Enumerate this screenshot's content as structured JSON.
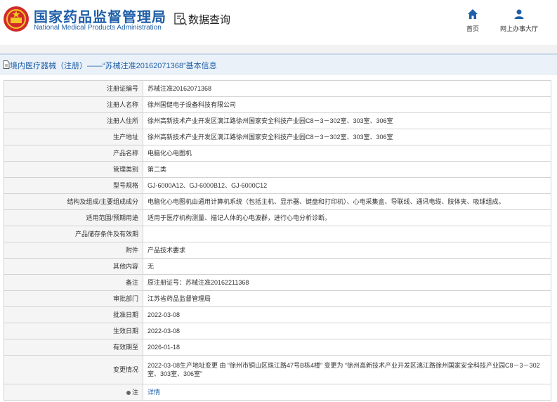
{
  "header": {
    "site_name": "国家药品监督管理局",
    "site_name_en": "National Medical Products Administration",
    "query_title": "数据查询",
    "nav": [
      {
        "label": "首页",
        "icon": "home-icon"
      },
      {
        "label": "网上办事大厅",
        "icon": "user-icon"
      }
    ]
  },
  "colors": {
    "brand": "#1f5fa8",
    "title_bar_bg": "#eaf1f8",
    "label_bg": "#f5f5f5"
  },
  "page": {
    "title": "境内医疗器械（注册）——“苏械注准20162071368”基本信息"
  },
  "fields": [
    {
      "label": "注册证编号",
      "value": "苏械注准20162071368"
    },
    {
      "label": "注册人名称",
      "value": "徐州国健电子设备科技有限公司"
    },
    {
      "label": "注册人住所",
      "value": "徐州高新技术产业开发区漓江路徐州国家安全科技产业园C8－3－302室、303室、306室"
    },
    {
      "label": "生产地址",
      "value": "徐州高新技术产业开发区漓江路徐州国家安全科技产业园C8－3－302室、303室、306室"
    },
    {
      "label": "产品名称",
      "value": "电脑化心电图机"
    },
    {
      "label": "管理类别",
      "value": "第二类"
    },
    {
      "label": "型号规格",
      "value": "GJ-6000A12、GJ-6000B12、GJ-6000C12"
    },
    {
      "label": "结构及组成/主要组成成分",
      "value": "电脑化心电图机由通用计算机系统（包括主机、显示器、键盘和打印机）、心电采集盒、导联线、通讯电缆、肢体夹、吸球组成。"
    },
    {
      "label": "适用范围/预期用途",
      "value": "适用于医疗机构测量、描记人体的心电波群，进行心电分析诊断。"
    },
    {
      "label": "产品储存条件及有效期",
      "value": ""
    },
    {
      "label": "附件",
      "value": "产品技术要求"
    },
    {
      "label": "其他内容",
      "value": "无"
    },
    {
      "label": "备注",
      "value": "原注册证号：苏械注准20162211368"
    },
    {
      "label": "审批部门",
      "value": "江苏省药品监督管理局"
    },
    {
      "label": "批准日期",
      "value": "2022-03-08"
    },
    {
      "label": "生效日期",
      "value": "2022-03-08"
    },
    {
      "label": "有效期至",
      "value": "2026-01-18"
    },
    {
      "label": "变更情况",
      "value": "2022-03-08生产地址变更 由 “徐州市铜山区珠江路47号B栋4楼” 变更为 “徐州高新技术产业开发区漓江路徐州国家安全科技产业园C8－3－302室、303室、306室”"
    }
  ],
  "note": {
    "label": "注",
    "link_text": "详情"
  }
}
